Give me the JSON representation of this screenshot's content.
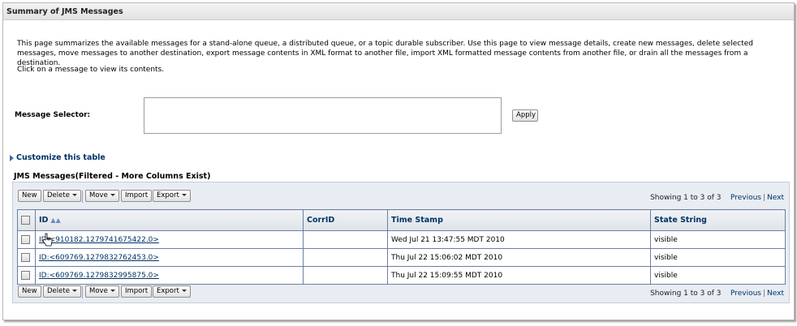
{
  "panel": {
    "title": "Summary of JMS Messages"
  },
  "description": "This page summarizes the available messages for a stand-alone queue, a distributed queue, or a topic durable subscriber. Use this page to view message details, create new messages, delete selected messages, move messages to another destination, export message contents in XML format to another file, import XML formatted message contents from another file, or drain all the messages from a destination.",
  "click_hint": "Click on a message to view its contents.",
  "selector": {
    "label": "Message Selector:",
    "value": "",
    "apply_label": "Apply"
  },
  "customize": {
    "label": "Customize this table"
  },
  "table": {
    "title": "JMS Messages(Filtered - More Columns Exist)",
    "toolbar": {
      "new_label": "New",
      "delete_label": "Delete",
      "move_label": "Move",
      "import_label": "Import",
      "export_label": "Export"
    },
    "paging": {
      "showing": "Showing 1 to 3 of 3",
      "previous": "Previous",
      "separator": "|",
      "next": "Next"
    },
    "columns": [
      "ID",
      "CorrID",
      "Time Stamp",
      "State String"
    ],
    "rows": [
      {
        "id": "ID:<910182.1279741675422.0>",
        "corrid": "",
        "timestamp": "Wed Jul 21 13:47:55 MDT 2010",
        "state": "visible"
      },
      {
        "id": "ID:<609769.1279832762453.0>",
        "corrid": "",
        "timestamp": "Thu Jul 22 15:06:02 MDT 2010",
        "state": "visible"
      },
      {
        "id": "ID:<609769.1279832995875.0>",
        "corrid": "",
        "timestamp": "Thu Jul 22 15:09:55 MDT 2010",
        "state": "visible"
      }
    ]
  },
  "colors": {
    "link": "#003366",
    "grid_border": "#6d7f9d",
    "table_bg": "#e8edf3"
  },
  "icons": {
    "sort": "sort-ascending-icon",
    "customize": "expand-triangle-icon",
    "cursor": "hand-cursor-icon"
  }
}
